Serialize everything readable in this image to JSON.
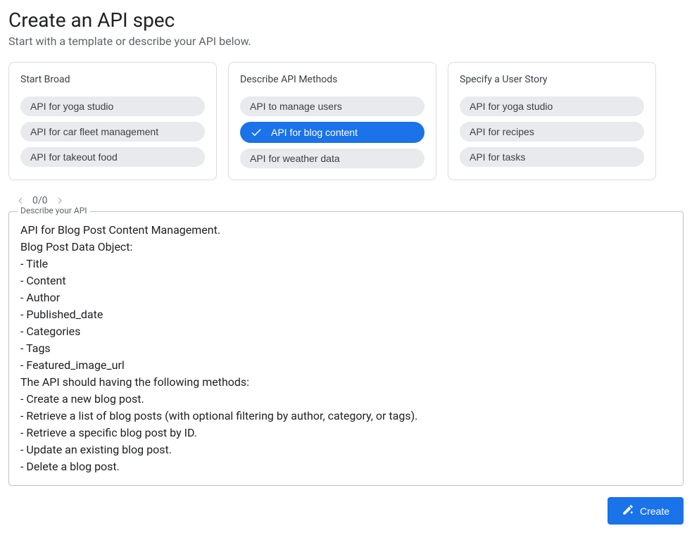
{
  "header": {
    "title": "Create an API spec",
    "subtitle": "Start with a template or describe your API below."
  },
  "cards": [
    {
      "title": "Start Broad",
      "chips": [
        {
          "label": "API for yoga studio",
          "selected": false
        },
        {
          "label": "API for car fleet management",
          "selected": false
        },
        {
          "label": "API for takeout food",
          "selected": false
        }
      ]
    },
    {
      "title": "Describe API Methods",
      "chips": [
        {
          "label": "API to manage users",
          "selected": false
        },
        {
          "label": "API for blog content",
          "selected": true
        },
        {
          "label": "API for weather data",
          "selected": false
        }
      ]
    },
    {
      "title": "Specify a User Story",
      "chips": [
        {
          "label": "API for yoga studio",
          "selected": false
        },
        {
          "label": "API for recipes",
          "selected": false
        },
        {
          "label": "API for tasks",
          "selected": false
        }
      ]
    }
  ],
  "pager": {
    "text": "0/0"
  },
  "describe": {
    "legend": "Describe your API",
    "value": "API for Blog Post Content Management.\nBlog Post Data Object:\n- Title\n- Content\n- Author\n- Published_date\n- Categories\n- Tags\n- Featured_image_url\nThe API should having the following methods:\n- Create a new blog post.\n- Retrieve a list of blog posts (with optional filtering by author, category, or tags).\n- Retrieve a specific blog post by ID.\n- Update an existing blog post.\n- Delete a blog post."
  },
  "actions": {
    "create_label": "Create"
  }
}
